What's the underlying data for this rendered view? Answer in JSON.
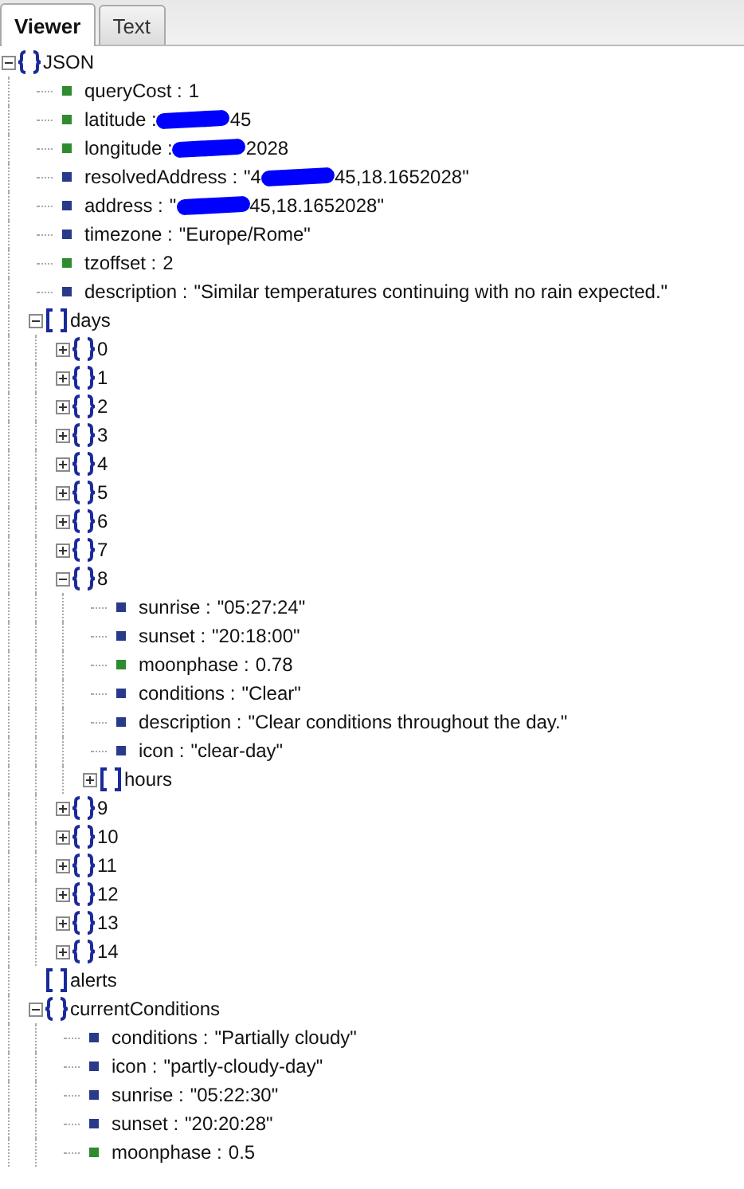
{
  "tabs": [
    {
      "label": "Viewer",
      "selected": true
    },
    {
      "label": "Text",
      "selected": false
    }
  ],
  "tree": {
    "kind": "object",
    "key": "JSON",
    "expanded": true,
    "children": [
      {
        "kind": "leaf",
        "key": "queryCost :",
        "color": "#2e8b2e",
        "value": "1"
      },
      {
        "kind": "leaf",
        "key": "latitude :",
        "color": "#2e8b2e",
        "value": "45",
        "redacted": true
      },
      {
        "kind": "leaf",
        "key": "longitude :",
        "color": "#2e8b2e",
        "value": "2028",
        "redacted": true
      },
      {
        "kind": "leaf",
        "key": "resolvedAddress :",
        "color": "#2a3a8a",
        "value_head": "\"4",
        "value": "45,18.1652028\"",
        "redacted": true
      },
      {
        "kind": "leaf",
        "key": "address :",
        "color": "#2a3a8a",
        "value_head": "\"",
        "value": "45,18.1652028\"",
        "redacted": true
      },
      {
        "kind": "leaf",
        "key": "timezone :",
        "color": "#2a3a8a",
        "value": "\"Europe/Rome\""
      },
      {
        "kind": "leaf",
        "key": "tzoffset :",
        "color": "#2e8b2e",
        "value": "2"
      },
      {
        "kind": "leaf",
        "key": "description :",
        "color": "#2a3a8a",
        "value": "\"Similar temperatures continuing with no rain expected.\""
      },
      {
        "kind": "array",
        "key": "days",
        "expanded": true,
        "children": [
          {
            "kind": "object",
            "key": "0",
            "expanded": false
          },
          {
            "kind": "object",
            "key": "1",
            "expanded": false
          },
          {
            "kind": "object",
            "key": "2",
            "expanded": false
          },
          {
            "kind": "object",
            "key": "3",
            "expanded": false
          },
          {
            "kind": "object",
            "key": "4",
            "expanded": false
          },
          {
            "kind": "object",
            "key": "5",
            "expanded": false
          },
          {
            "kind": "object",
            "key": "6",
            "expanded": false
          },
          {
            "kind": "object",
            "key": "7",
            "expanded": false
          },
          {
            "kind": "object",
            "key": "8",
            "expanded": true,
            "children": [
              {
                "kind": "leaf",
                "key": "sunrise :",
                "color": "#2a3a8a",
                "value": "\"05:27:24\""
              },
              {
                "kind": "leaf",
                "key": "sunset :",
                "color": "#2a3a8a",
                "value": "\"20:18:00\""
              },
              {
                "kind": "leaf",
                "key": "moonphase :",
                "color": "#2e8b2e",
                "value": "0.78"
              },
              {
                "kind": "leaf",
                "key": "conditions :",
                "color": "#2a3a8a",
                "value": "\"Clear\""
              },
              {
                "kind": "leaf",
                "key": "description :",
                "color": "#2a3a8a",
                "value": "\"Clear conditions throughout the day.\""
              },
              {
                "kind": "leaf",
                "key": "icon :",
                "color": "#2a3a8a",
                "value": "\"clear-day\""
              },
              {
                "kind": "array",
                "key": "hours",
                "expanded": false
              }
            ]
          },
          {
            "kind": "object",
            "key": "9",
            "expanded": false
          },
          {
            "kind": "object",
            "key": "10",
            "expanded": false
          },
          {
            "kind": "object",
            "key": "11",
            "expanded": false
          },
          {
            "kind": "object",
            "key": "12",
            "expanded": false
          },
          {
            "kind": "object",
            "key": "13",
            "expanded": false
          },
          {
            "kind": "object",
            "key": "14",
            "expanded": false
          }
        ]
      },
      {
        "kind": "array",
        "key": "alerts"
      },
      {
        "kind": "object",
        "key": "currentConditions",
        "expanded": true,
        "children": [
          {
            "kind": "leaf",
            "key": "conditions :",
            "color": "#2a3a8a",
            "value": "\"Partially cloudy\""
          },
          {
            "kind": "leaf",
            "key": "icon :",
            "color": "#2a3a8a",
            "value": "\"partly-cloudy-day\""
          },
          {
            "kind": "leaf",
            "key": "sunrise :",
            "color": "#2a3a8a",
            "value": "\"05:22:30\""
          },
          {
            "kind": "leaf",
            "key": "sunset :",
            "color": "#2a3a8a",
            "value": "\"20:20:28\""
          },
          {
            "kind": "leaf",
            "key": "moonphase :",
            "color": "#2e8b2e",
            "value": "0.5"
          }
        ]
      }
    ]
  }
}
